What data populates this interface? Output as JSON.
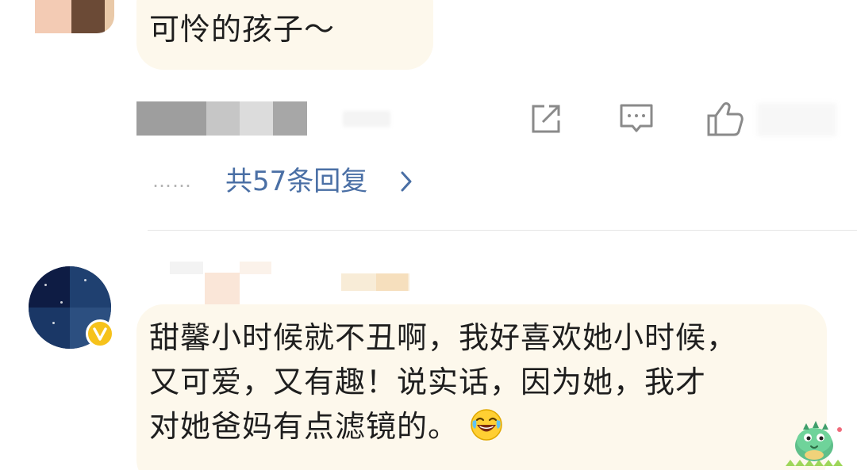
{
  "comment_1": {
    "text": "可怜的孩子～",
    "replies_dots": "……",
    "replies_link": "共57条回复",
    "actions": {
      "share_icon": "share-icon",
      "comment_icon": "comment-icon",
      "like_icon": "thumbs-up-icon"
    }
  },
  "comment_2": {
    "lines": [
      "甜馨小时候就不丑啊，我好喜欢她小时候，",
      "又可爱，又有趣！说实话，因为她，我才",
      "对她爸妈有点滤镜的。"
    ],
    "emoji": "laughing-tears-emoji",
    "badge": "verified-badge",
    "sticker": "green-dinosaur-sticker"
  },
  "colors": {
    "bubble_bg": "#fdf8ec",
    "link": "#4a6fa5",
    "text": "#1e1e1e",
    "icon": "#8a8a8a",
    "badge": "#f6c21b"
  }
}
